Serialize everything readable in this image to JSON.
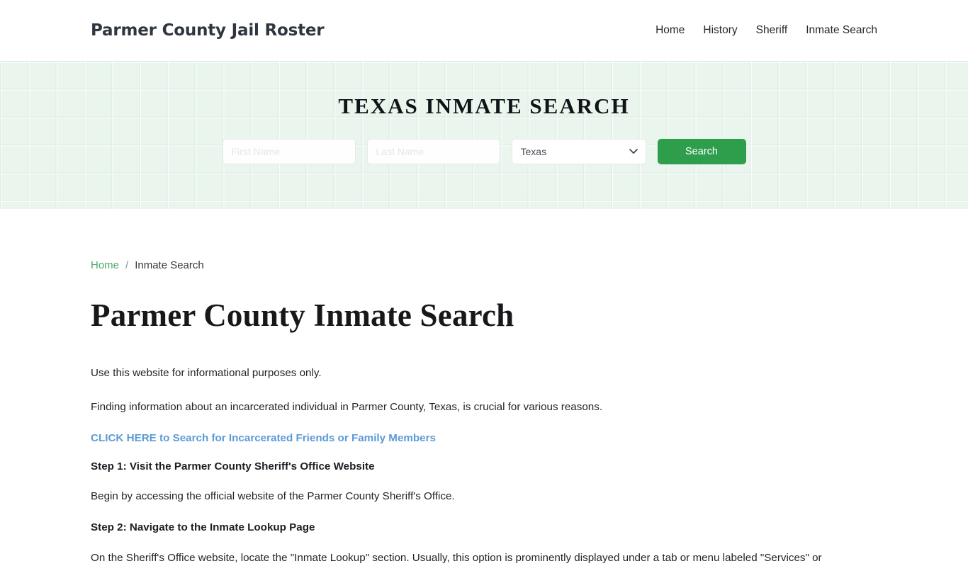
{
  "header": {
    "brand": "Parmer County Jail Roster",
    "nav": [
      {
        "label": "Home"
      },
      {
        "label": "History"
      },
      {
        "label": "Sheriff"
      },
      {
        "label": "Inmate Search"
      }
    ]
  },
  "hero": {
    "title": "TEXAS INMATE SEARCH",
    "first_name_placeholder": "First Name",
    "first_name_value": "",
    "last_name_placeholder": "Last Name",
    "last_name_value": "",
    "state_selected": "Texas",
    "state_options": [
      "Texas"
    ],
    "search_label": "Search",
    "accent_green": "#2e9e4c",
    "background": "#eaf5ee"
  },
  "breadcrumb": {
    "home": "Home",
    "separator": "/",
    "current": "Inmate Search"
  },
  "main": {
    "page_title": "Parmer County Inmate Search",
    "paragraph_1": "Use this website for informational purposes only.",
    "paragraph_2": "Finding information about an incarcerated individual in Parmer County, Texas, is crucial for various reasons.",
    "cta_link": "CLICK HERE to Search for Incarcerated Friends or Family Members",
    "step_1_heading": "Step 1: Visit the Parmer County Sheriff's Office Website",
    "step_1_text": "Begin by accessing the official website of the Parmer County Sheriff's Office.",
    "step_2_heading": "Step 2: Navigate to the Inmate Lookup Page",
    "step_2_text": "On the Sheriff's Office website, locate the \"Inmate Lookup\" section. Usually, this option is prominently displayed under a tab or menu labeled \"Services\" or",
    "link_color": "#5b9bd5"
  }
}
